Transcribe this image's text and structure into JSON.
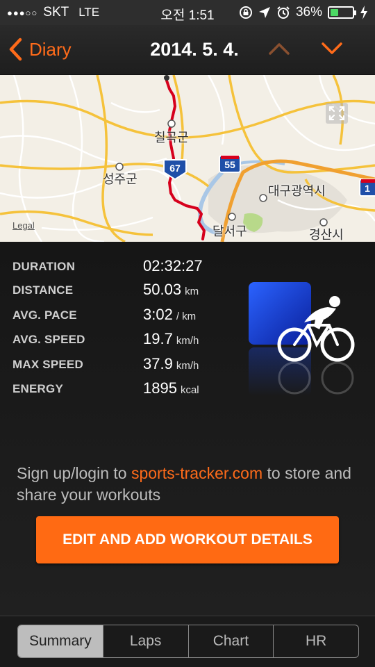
{
  "status": {
    "carrier": "SKT",
    "network": "LTE",
    "time": "오전 1:51",
    "battery": "36%",
    "battery_level": 0.36
  },
  "nav": {
    "back_label": "Diary",
    "title": "2014. 5. 4."
  },
  "map": {
    "labels": {
      "chilgok": "칠곡군",
      "seongju": "성주군",
      "daegu": "대구광역시",
      "dalseo": "달서구",
      "gyeongsan": "경산시",
      "route67": "67",
      "route55": "55",
      "route1": "1"
    },
    "legal": "Legal"
  },
  "stats": [
    {
      "label": "DURATION",
      "value": "02:32:27",
      "unit": ""
    },
    {
      "label": "DISTANCE",
      "value": "50.03",
      "unit": "km"
    },
    {
      "label": "AVG. PACE",
      "value": "3:02",
      "unit": "/ km"
    },
    {
      "label": "AVG. SPEED",
      "value": "19.7",
      "unit": "km/h"
    },
    {
      "label": "MAX SPEED",
      "value": "37.9",
      "unit": "km/h"
    },
    {
      "label": "ENERGY",
      "value": "1895",
      "unit": "kcal"
    }
  ],
  "promo": {
    "prefix": "Sign up/login to ",
    "link": "sports-tracker.com",
    "suffix": " to store and share your workouts"
  },
  "edit_button": "EDIT AND ADD WORKOUT DETAILS",
  "tabs": [
    {
      "label": "Summary",
      "active": true
    },
    {
      "label": "Laps",
      "active": false
    },
    {
      "label": "Chart",
      "active": false
    },
    {
      "label": "HR",
      "active": false
    }
  ],
  "colors": {
    "accent": "#ff6b1a",
    "route": "#d6001c",
    "battery": "#4cd964"
  }
}
